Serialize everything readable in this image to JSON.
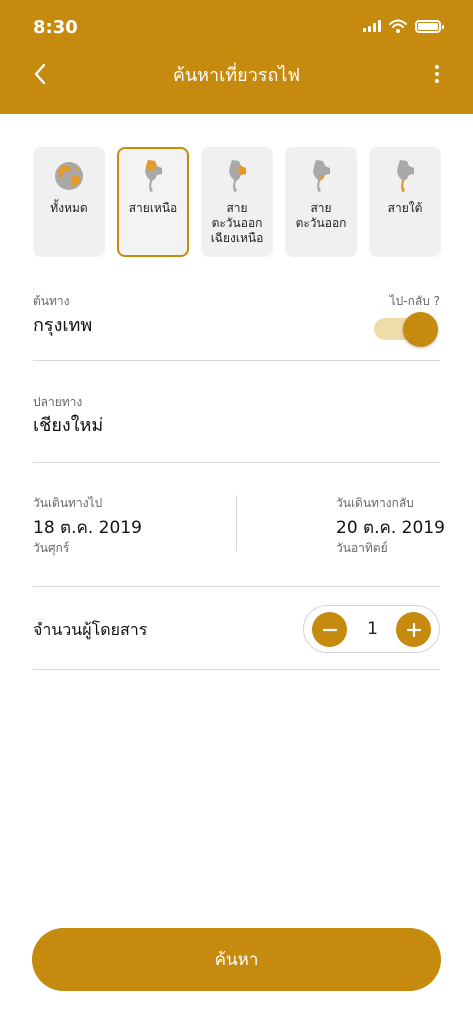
{
  "status_bar": {
    "time": "8:30"
  },
  "header": {
    "title": "ค้นหาเที่ยวรถไฟ",
    "back_icon": "chevron-left-icon",
    "menu_icon": "more-vertical-icon"
  },
  "regions": [
    {
      "label": "ทั้งหมด",
      "icon": "globe-icon",
      "selected": false
    },
    {
      "label": "สายเหนือ",
      "icon": "thailand-map-north-icon",
      "selected": true
    },
    {
      "label": "สาย\nตะวันออก\nเฉียงเหนือ",
      "icon": "thailand-map-northeast-icon",
      "selected": false
    },
    {
      "label": "สาย\nตะวันออก",
      "icon": "thailand-map-east-icon",
      "selected": false
    },
    {
      "label": "สายใต้",
      "icon": "thailand-map-south-icon",
      "selected": false
    }
  ],
  "origin": {
    "label": "ต้นทาง",
    "value": "กรุงเทพ"
  },
  "round_trip": {
    "label": "ไป-กลับ ?",
    "enabled": true
  },
  "destination": {
    "label": "ปลายทาง",
    "value": "เชียงใหม่"
  },
  "depart": {
    "label": "วันเดินทางไป",
    "date": "18 ต.ค. 2019",
    "day": "วันศุกร์"
  },
  "return": {
    "label": "วันเดินทางกลับ",
    "date": "20 ต.ค. 2019",
    "day": "วันอาทิตย์"
  },
  "passengers": {
    "label": "จำนวนผู้โดยสาร",
    "count": "1"
  },
  "search_button": {
    "label": "ค้นหา"
  },
  "colors": {
    "accent": "#c58a0e",
    "accent_light": "#f0dca8",
    "region_bg": "#f0f0f0"
  }
}
